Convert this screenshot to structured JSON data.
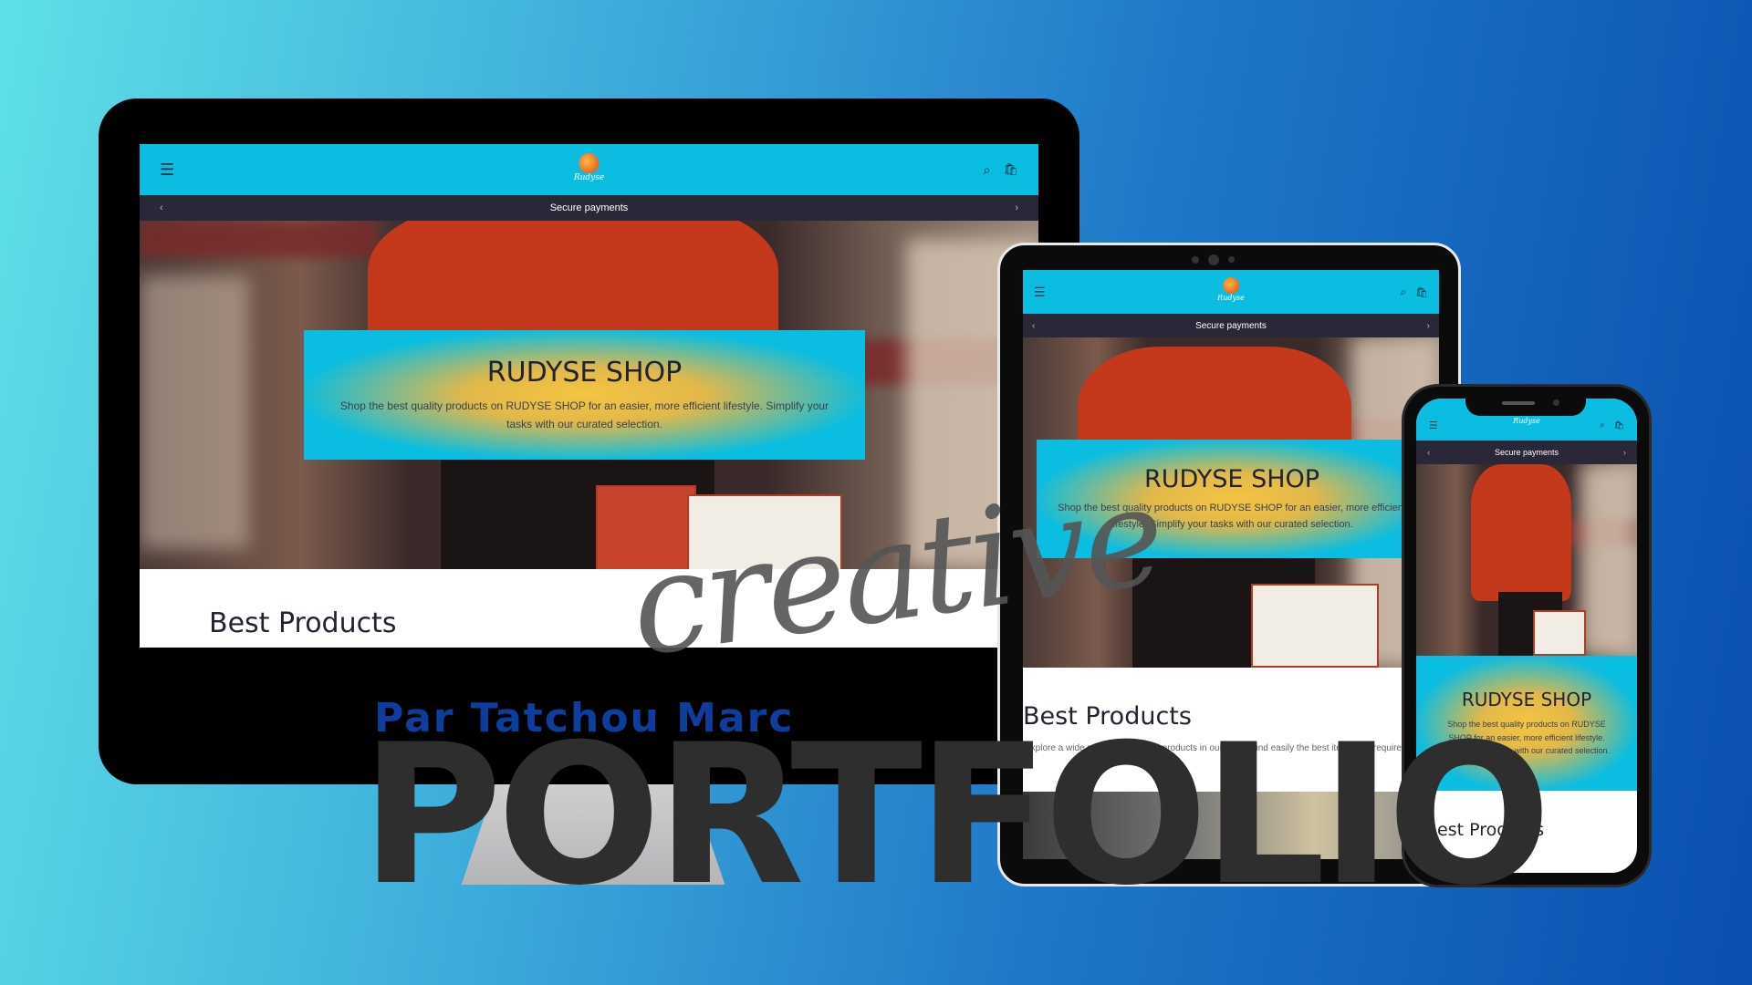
{
  "site": {
    "logo_text": "Rudyse",
    "announcement": "Secure payments",
    "banner_title": "RUDYSE SHOP",
    "banner_text": "Shop the best quality products on RUDYSE SHOP for an easier, more efficient lifestyle. Simplify your tasks with our curated selection.",
    "section_title": "Best Products",
    "section_subtitle": "Explore a wide range of top-rated products in our store. Find easily the best items you require."
  },
  "icons": {
    "menu": "menu-icon",
    "search": "search-icon",
    "cart": "cart-icon",
    "prev": "chevron-left-icon",
    "next": "chevron-right-icon"
  },
  "overlay": {
    "byline": "Par Tatchou Marc",
    "headline": "PORTFOLIO",
    "script_word": "creative"
  },
  "colors": {
    "header": "#0bbde0",
    "announcement_bar": "#2a2838",
    "banner_glow": "#f4c542",
    "byline": "#0d3e9e",
    "headline": "#2e2e2e"
  }
}
